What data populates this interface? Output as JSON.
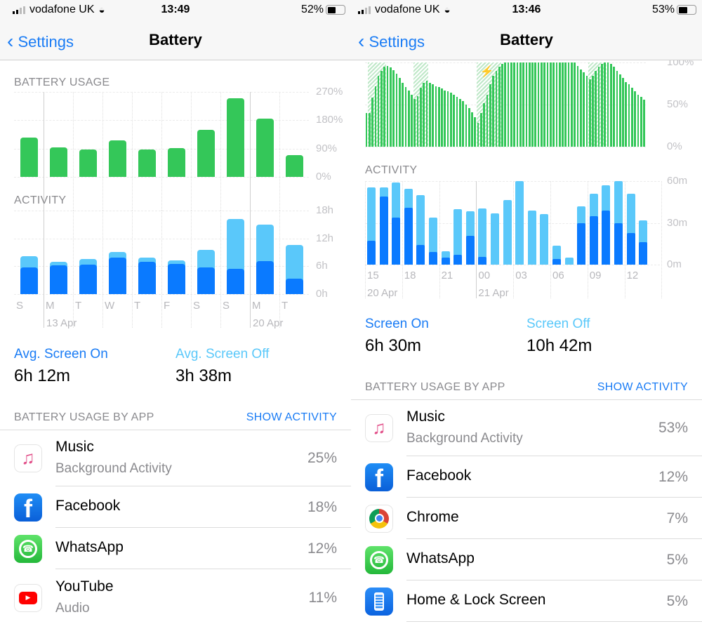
{
  "colors": {
    "accent": "#1a7cf5",
    "green": "#34c759",
    "screen_on": "#0a7aff",
    "screen_off": "#5ac8fa",
    "charging_hatch": "#bfe8c8"
  },
  "left": {
    "status": {
      "carrier": "vodafone UK",
      "time": "13:49",
      "battery": "52%",
      "battery_fraction": 0.52
    },
    "nav": {
      "back": "Settings",
      "title": "Battery"
    },
    "battery_usage_title": "BATTERY USAGE",
    "activity_title": "ACTIVITY",
    "summary": {
      "on_label": "Avg. Screen On",
      "on_value": "6h 12m",
      "off_label": "Avg. Screen Off",
      "off_value": "3h 38m"
    },
    "apps_header": "BATTERY USAGE BY APP",
    "show_activity": "SHOW ACTIVITY",
    "apps": [
      {
        "name": "Music",
        "sub": "Background Activity",
        "pct": "25%",
        "icon": "music-icon"
      },
      {
        "name": "Facebook",
        "pct": "18%",
        "icon": "facebook-icon"
      },
      {
        "name": "WhatsApp",
        "pct": "12%",
        "icon": "whatsapp-icon"
      },
      {
        "name": "YouTube",
        "sub": "Audio",
        "pct": "11%",
        "icon": "youtube-icon"
      }
    ]
  },
  "right": {
    "status": {
      "carrier": "vodafone UK",
      "time": "13:46",
      "battery": "53%",
      "battery_fraction": 0.53
    },
    "nav": {
      "back": "Settings",
      "title": "Battery"
    },
    "activity_title": "ACTIVITY",
    "summary": {
      "on_label": "Screen On",
      "on_value": "6h 30m",
      "off_label": "Screen Off",
      "off_value": "10h 42m"
    },
    "apps_header": "BATTERY USAGE BY APP",
    "show_activity": "SHOW ACTIVITY",
    "apps": [
      {
        "name": "Music",
        "sub": "Background Activity",
        "pct": "53%",
        "icon": "music-icon"
      },
      {
        "name": "Facebook",
        "pct": "12%",
        "icon": "facebook-icon"
      },
      {
        "name": "Chrome",
        "pct": "7%",
        "icon": "chrome-icon"
      },
      {
        "name": "WhatsApp",
        "pct": "5%",
        "icon": "whatsapp-icon"
      },
      {
        "name": "Home & Lock Screen",
        "pct": "5%",
        "icon": "home-lock-screen-icon"
      }
    ]
  },
  "chart_data": [
    {
      "type": "bar",
      "title": "BATTERY USAGE",
      "categories": [
        "S",
        "M",
        "T",
        "W",
        "T",
        "F",
        "S",
        "S",
        "M",
        "T"
      ],
      "date_labels": [
        "13 Apr",
        "20 Apr"
      ],
      "values": [
        124,
        94,
        88,
        116,
        88,
        92,
        150,
        249,
        185,
        70
      ],
      "yticks": [
        "270%",
        "180%",
        "90%",
        "0%"
      ],
      "ylim": [
        0,
        270
      ],
      "grid": true
    },
    {
      "type": "bar",
      "stacked": true,
      "title": "ACTIVITY",
      "categories": [
        "S",
        "M",
        "T",
        "W",
        "T",
        "F",
        "S",
        "S",
        "M",
        "T"
      ],
      "date_labels": [
        "13 Apr",
        "20 Apr"
      ],
      "series": [
        {
          "values": [
            5.8,
            6.2,
            6.4,
            7.9,
            7.0,
            6.5,
            5.7,
            5.4,
            7.1,
            3.3
          ]
        },
        {
          "values": [
            2.3,
            0.7,
            1.1,
            1.2,
            0.8,
            0.8,
            3.8,
            10.8,
            7.9,
            7.3
          ]
        }
      ],
      "yticks": [
        "18h",
        "12h",
        "6h",
        "0h"
      ],
      "ylim": [
        0,
        18
      ],
      "grid": true
    },
    {
      "type": "bar",
      "title": "",
      "yticks": [
        "100%",
        "50%",
        "0%"
      ],
      "ylim": [
        0,
        100
      ],
      "grid": true,
      "values": [
        40,
        40,
        58,
        72,
        84,
        90,
        95,
        96,
        94,
        91,
        87,
        82,
        76,
        71,
        67,
        62,
        57,
        60,
        70,
        76,
        78,
        76,
        74,
        72,
        71,
        69,
        67,
        66,
        64,
        62,
        59,
        57,
        54,
        50,
        46,
        41,
        35,
        28,
        40,
        52,
        62,
        74,
        84,
        90,
        95,
        98,
        100,
        100,
        100,
        100,
        100,
        100,
        100,
        100,
        100,
        100,
        100,
        100,
        100,
        100,
        100,
        100,
        100,
        100,
        100,
        100,
        100,
        100,
        100,
        100,
        96,
        92,
        88,
        84,
        80,
        84,
        90,
        95,
        98,
        100,
        100,
        98,
        95,
        90,
        86,
        82,
        77,
        74,
        70,
        66,
        62,
        59,
        56
      ],
      "charging": [
        [
          1,
          6
        ],
        [
          16,
          20
        ],
        [
          37,
          44
        ],
        [
          74,
          79
        ]
      ]
    },
    {
      "type": "bar",
      "stacked": true,
      "title": "ACTIVITY",
      "x_tick_labels": [
        "15",
        "18",
        "21",
        "00",
        "03",
        "06",
        "09",
        "12"
      ],
      "date_labels": [
        "20 Apr",
        "21 Apr"
      ],
      "series": [
        {
          "values": [
            16.9,
            49.1,
            33.7,
            40.9,
            13.9,
            8.9,
            4.9,
            6.9,
            20.9,
            5.7,
            0,
            0,
            0,
            0,
            0,
            3.9,
            0,
            30,
            35,
            38.9,
            30,
            22.8,
            15.9
          ]
        },
        {
          "values": [
            38.7,
            6.5,
            25.4,
            13.5,
            36,
            24.8,
            4.8,
            33,
            17.5,
            34.5,
            36.7,
            46.6,
            60,
            38.7,
            36.2,
            9.8,
            5.2,
            11.7,
            15.8,
            18.1,
            30,
            28.1,
            15.8
          ]
        }
      ],
      "yticks": [
        "60m",
        "30m",
        "0m"
      ],
      "ylim": [
        0,
        60
      ],
      "grid": true
    }
  ]
}
